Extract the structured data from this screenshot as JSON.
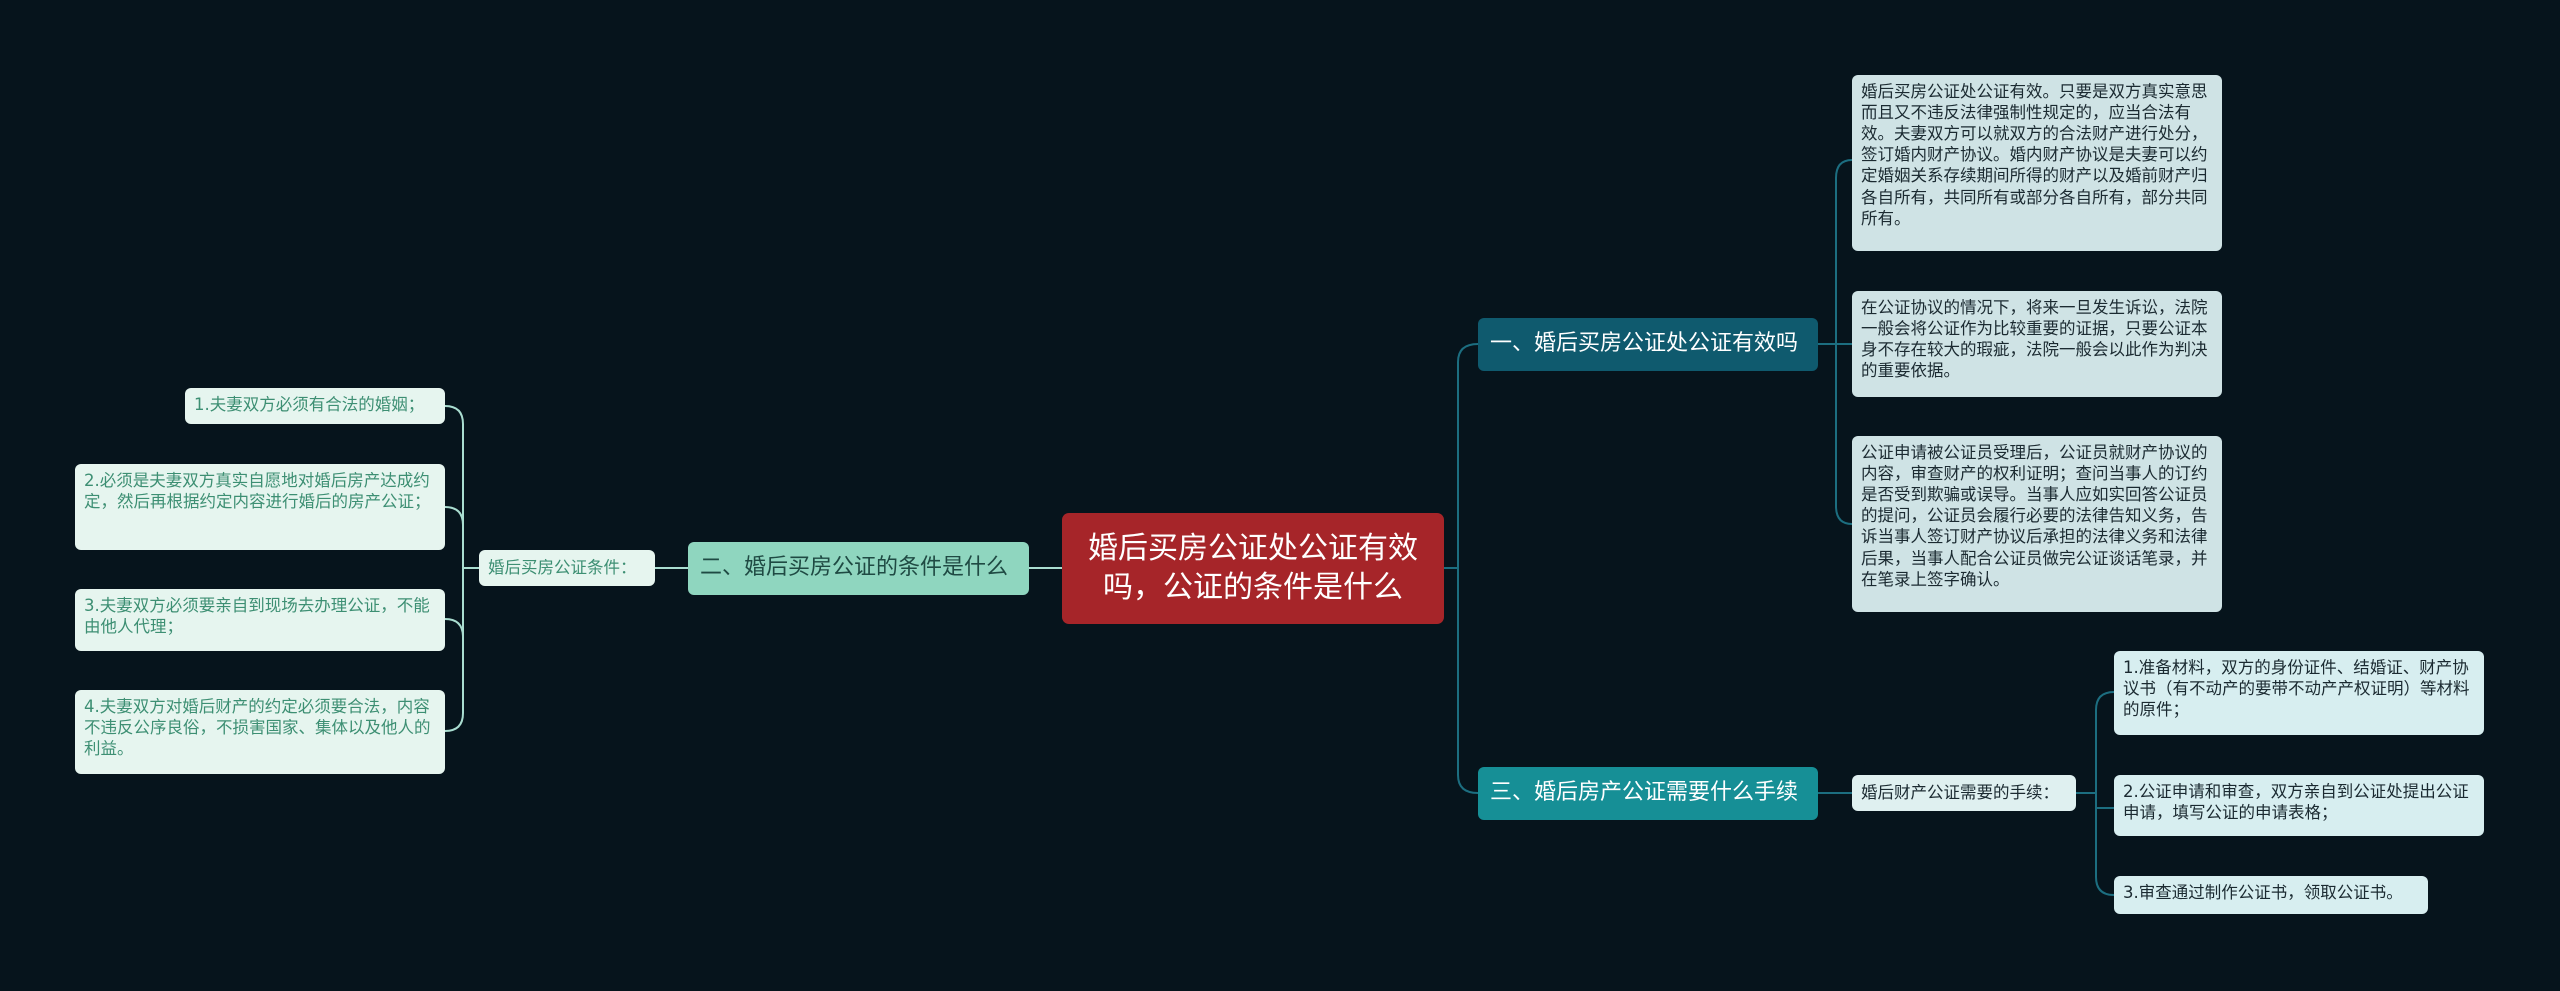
{
  "mindmap": {
    "root": "婚后买房公证处公证有效吗，公证的条件是什么",
    "branches": [
      {
        "label": "一、婚后买房公证处公证有效吗",
        "children": [
          "婚后买房公证处公证有效。只要是双方真实意思而且又不违反法律强制性规定的，应当合法有效。夫妻双方可以就双方的合法财产进行处分，签订婚内财产协议。婚内财产协议是夫妻可以约定婚姻关系存续期间所得的财产以及婚前财产归各自所有，共同所有或部分各自所有，部分共同所有。",
          "在公证协议的情况下，将来一旦发生诉讼，法院一般会将公证作为比较重要的证据，只要公证本身不存在较大的瑕疵，法院一般会以此作为判决的重要依据。",
          "公证申请被公证员受理后，公证员就财产协议的内容，审查财产的权利证明；查问当事人的订约是否受到欺骗或误导。当事人应如实回答公证员的提问，公证员会履行必要的法律告知义务，告诉当事人签订财产协议后承担的法律义务和法律后果，当事人配合公证员做完公证谈话笔录，并在笔录上签字确认。"
        ]
      },
      {
        "label": "二、婚后买房公证的条件是什么",
        "sub_label": "婚后买房公证条件：",
        "children": [
          "1.夫妻双方必须有合法的婚姻；",
          "2.必须是夫妻双方真实自愿地对婚后房产达成约定，然后再根据约定内容进行婚后的房产公证；",
          "3.夫妻双方必须要亲自到现场去办理公证，不能由他人代理；",
          "4.夫妻双方对婚后财产的约定必须要合法，内容不违反公序良俗，不损害国家、集体以及他人的利益。"
        ]
      },
      {
        "label": "三、婚后房产公证需要什么手续",
        "sub_label": "婚后财产公证需要的手续：",
        "children": [
          "1.准备材料，双方的身份证件、结婚证、财产协议书（有不动产的要带不动产产权证明）等材料的原件；",
          "2.公证申请和审查，双方亲自到公证处提出公证申请，填写公证的申请表格；",
          "3.审查通过制作公证书，领取公证书。"
        ]
      }
    ]
  },
  "colors": {
    "background": "#06141c",
    "root": "#a62529",
    "branch1": "#0f5a6e",
    "branch2": "#8fd6bf",
    "branch3": "#168f96",
    "line_right": "#1c6e80",
    "line_left": "#a9ddd0"
  }
}
